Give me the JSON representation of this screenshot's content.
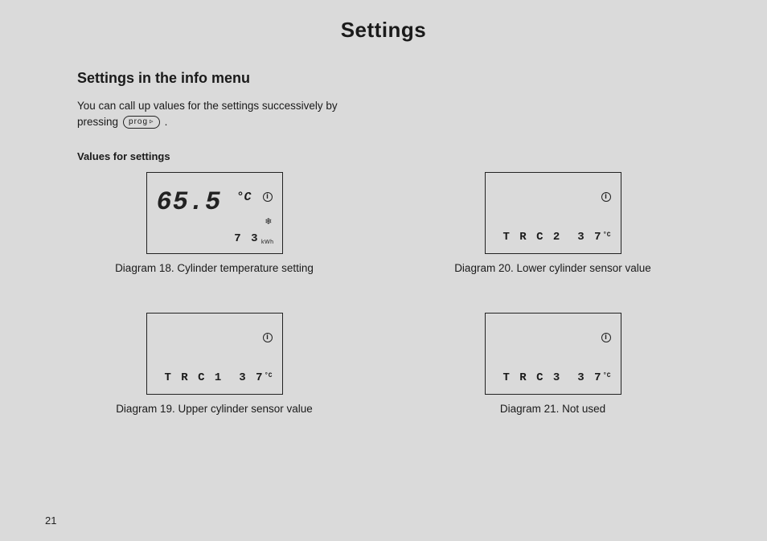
{
  "title": "Settings",
  "section_title": "Settings in the info menu",
  "intro_line1": "You can call up values for the settings successively by",
  "intro_line2_prefix": "pressing",
  "prog_label": "prog",
  "intro_line2_suffix": ".",
  "subhead": "Values for settings",
  "diagrams": {
    "d18": {
      "main_value": "65.5",
      "unit": "°C",
      "bottom_value": "7 3",
      "bottom_unit": "kWh",
      "caption": "Diagram 18. Cylinder temperature setting"
    },
    "d19": {
      "label": "T R C 1",
      "value": "3 7",
      "unit": "°C",
      "caption": "Diagram 19. Upper cylinder sensor value"
    },
    "d20": {
      "label": "T R C 2",
      "value": "3 7",
      "unit": "°C",
      "caption": "Diagram 20. Lower cylinder sensor value"
    },
    "d21": {
      "label": "T R C 3",
      "value": "3 7",
      "unit": "°C",
      "caption": "Diagram 21. Not used"
    }
  },
  "page_number": "21"
}
